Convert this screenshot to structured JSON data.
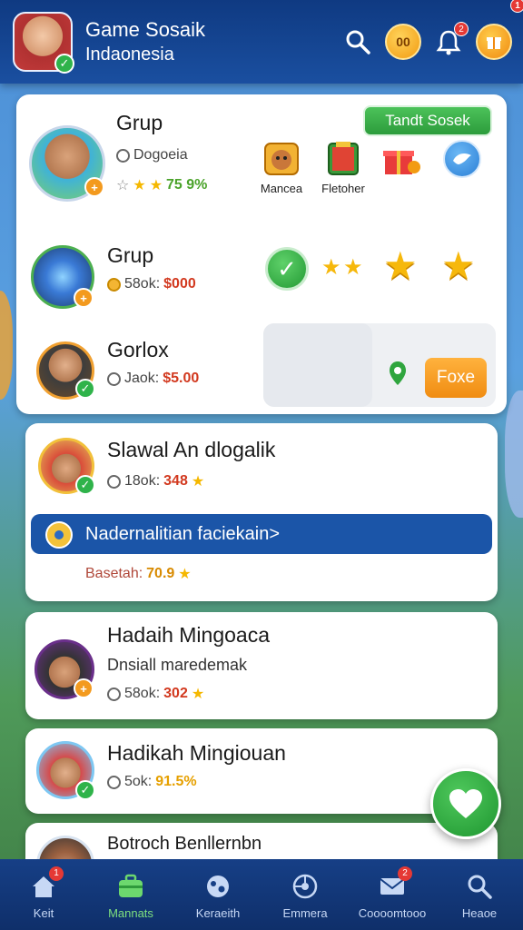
{
  "header": {
    "title": "Game Sosaik",
    "subtitle": "Indaonesia",
    "icons": [
      "search-icon",
      "coin-icon",
      "notification-icon",
      "gift-icon"
    ],
    "coin_label": "00",
    "notif_badge": "2",
    "gift_badge": "1"
  },
  "card1": {
    "action_label": "Tandt Sosek",
    "row1": {
      "title": "Grup",
      "sub_label": "Dogoeia",
      "rating_text": "75 9%",
      "tiles": [
        {
          "icon": "monkey-icon",
          "label": "Mancea"
        },
        {
          "icon": "book-icon",
          "label": "Fletoher"
        },
        {
          "icon": "gift-box-icon",
          "label": ""
        },
        {
          "icon": "bird-icon",
          "label": ""
        }
      ]
    },
    "row2": {
      "title": "Grup",
      "sub_label": "58ok:",
      "price": "$000"
    },
    "row3": {
      "title": "Gorlox",
      "sub_label": "Jaok:",
      "price": "$5.00",
      "button_label": "Foxe"
    }
  },
  "card2": {
    "title": "Slawal An dlogalik",
    "sub_label": "18ok:",
    "value": "348",
    "banner_text": "Nadernalitian faciekain>",
    "footer_label": "Basetah:",
    "footer_value": "70.9"
  },
  "card3": {
    "title": "Hadaih Mingoaca",
    "subtitle": "Dnsiall maredemak",
    "sub_label": "58ok:",
    "value": "302"
  },
  "card4": {
    "title": "Hadikah Mingiouan",
    "sub_label": "5ok:",
    "value": "91.5%"
  },
  "card5": {
    "title": "Botroch Benllernbn"
  },
  "nav": {
    "items": [
      {
        "label": "Keit",
        "icon": "home-icon",
        "badge": "1"
      },
      {
        "label": "Mannats",
        "icon": "briefcase-icon",
        "badge": ""
      },
      {
        "label": "Keraeith",
        "icon": "globe-icon",
        "badge": ""
      },
      {
        "label": "Emmera",
        "icon": "ball-icon",
        "badge": ""
      },
      {
        "label": "Coooomtooo",
        "icon": "mail-icon",
        "badge": "2"
      },
      {
        "label": "Heaoe",
        "icon": "search-icon",
        "badge": ""
      }
    ]
  },
  "colors": {
    "header_bg": "#1a4fa0",
    "accent_green": "#2fb34a",
    "accent_orange": "#f39a1e",
    "price_red": "#d2391f"
  }
}
